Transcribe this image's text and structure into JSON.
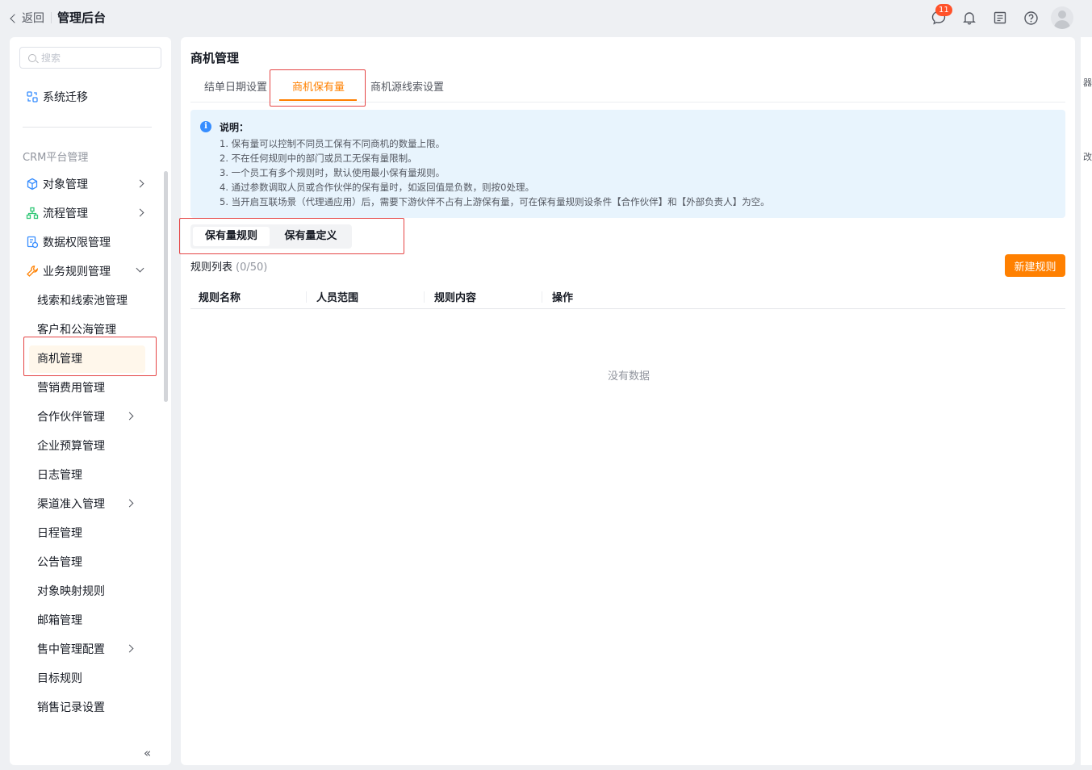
{
  "topbar": {
    "back_label": "返回",
    "title": "管理后台",
    "message_badge": "11"
  },
  "sidebar": {
    "search_placeholder": "搜索",
    "migrate_label": "系统迁移",
    "group_title": "CRM平台管理",
    "items": [
      {
        "label": "对象管理",
        "level": 1,
        "icon": "cube-icon",
        "arrow": "right"
      },
      {
        "label": "流程管理",
        "level": 1,
        "icon": "flow-icon",
        "arrow": "right"
      },
      {
        "label": "数据权限管理",
        "level": 1,
        "icon": "data-permission-icon",
        "arrow": ""
      },
      {
        "label": "业务规则管理",
        "level": 1,
        "icon": "wrench-icon",
        "arrow": "down"
      },
      {
        "label": "线索和线索池管理",
        "level": 2,
        "arrow": ""
      },
      {
        "label": "客户和公海管理",
        "level": 2,
        "arrow": ""
      },
      {
        "label": "商机管理",
        "level": 2,
        "arrow": "",
        "active": true
      },
      {
        "label": "营销费用管理",
        "level": 2,
        "arrow": ""
      },
      {
        "label": "合作伙伴管理",
        "level": 2,
        "arrow": "right"
      },
      {
        "label": "企业预算管理",
        "level": 2,
        "arrow": ""
      },
      {
        "label": "日志管理",
        "level": 2,
        "arrow": ""
      },
      {
        "label": "渠道准入管理",
        "level": 2,
        "arrow": "right"
      },
      {
        "label": "日程管理",
        "level": 2,
        "arrow": ""
      },
      {
        "label": "公告管理",
        "level": 2,
        "arrow": ""
      },
      {
        "label": "对象映射规则",
        "level": 2,
        "arrow": ""
      },
      {
        "label": "邮箱管理",
        "level": 2,
        "arrow": ""
      },
      {
        "label": "售中管理配置",
        "level": 2,
        "arrow": "right"
      },
      {
        "label": "目标规则",
        "level": 2,
        "arrow": ""
      },
      {
        "label": "销售记录设置",
        "level": 2,
        "arrow": ""
      }
    ],
    "collapse_glyph": "«"
  },
  "main": {
    "title": "商机管理",
    "tabs": [
      {
        "label": "结单日期设置"
      },
      {
        "label": "商机保有量",
        "active": true
      },
      {
        "label": "商机源线索设置"
      }
    ],
    "notice": {
      "title": "说明：",
      "lines": [
        "1. 保有量可以控制不同员工保有不同商机的数量上限。",
        "2. 不在任何规则中的部门或员工无保有量限制。",
        "3. 一个员工有多个规则时，默认使用最小保有量规则。",
        "4. 通过参数调取人员或合作伙伴的保有量时，如返回值是负数，则按0处理。",
        "5. 当开启互联场景（代理通应用）后，需要下游伙伴不占有上游保有量，可在保有量规则设条件【合作伙伴】和【外部负责人】为空。"
      ]
    },
    "segments": [
      {
        "label": "保有量规则",
        "active": true
      },
      {
        "label": "保有量定义"
      }
    ],
    "list_title": "规则列表",
    "list_count": "(0/50)",
    "new_button": "新建规则",
    "columns": [
      "规则名称",
      "人员范围",
      "规则内容",
      "操作"
    ],
    "empty_text": "没有数据"
  },
  "right_edge": {
    "top_text": "器",
    "mid_text": "改"
  },
  "colors": {
    "accent": "#ff8000",
    "highlight_box": "#e54545",
    "notice_bg": "#e8f4fd",
    "info_icon": "#368dff"
  }
}
